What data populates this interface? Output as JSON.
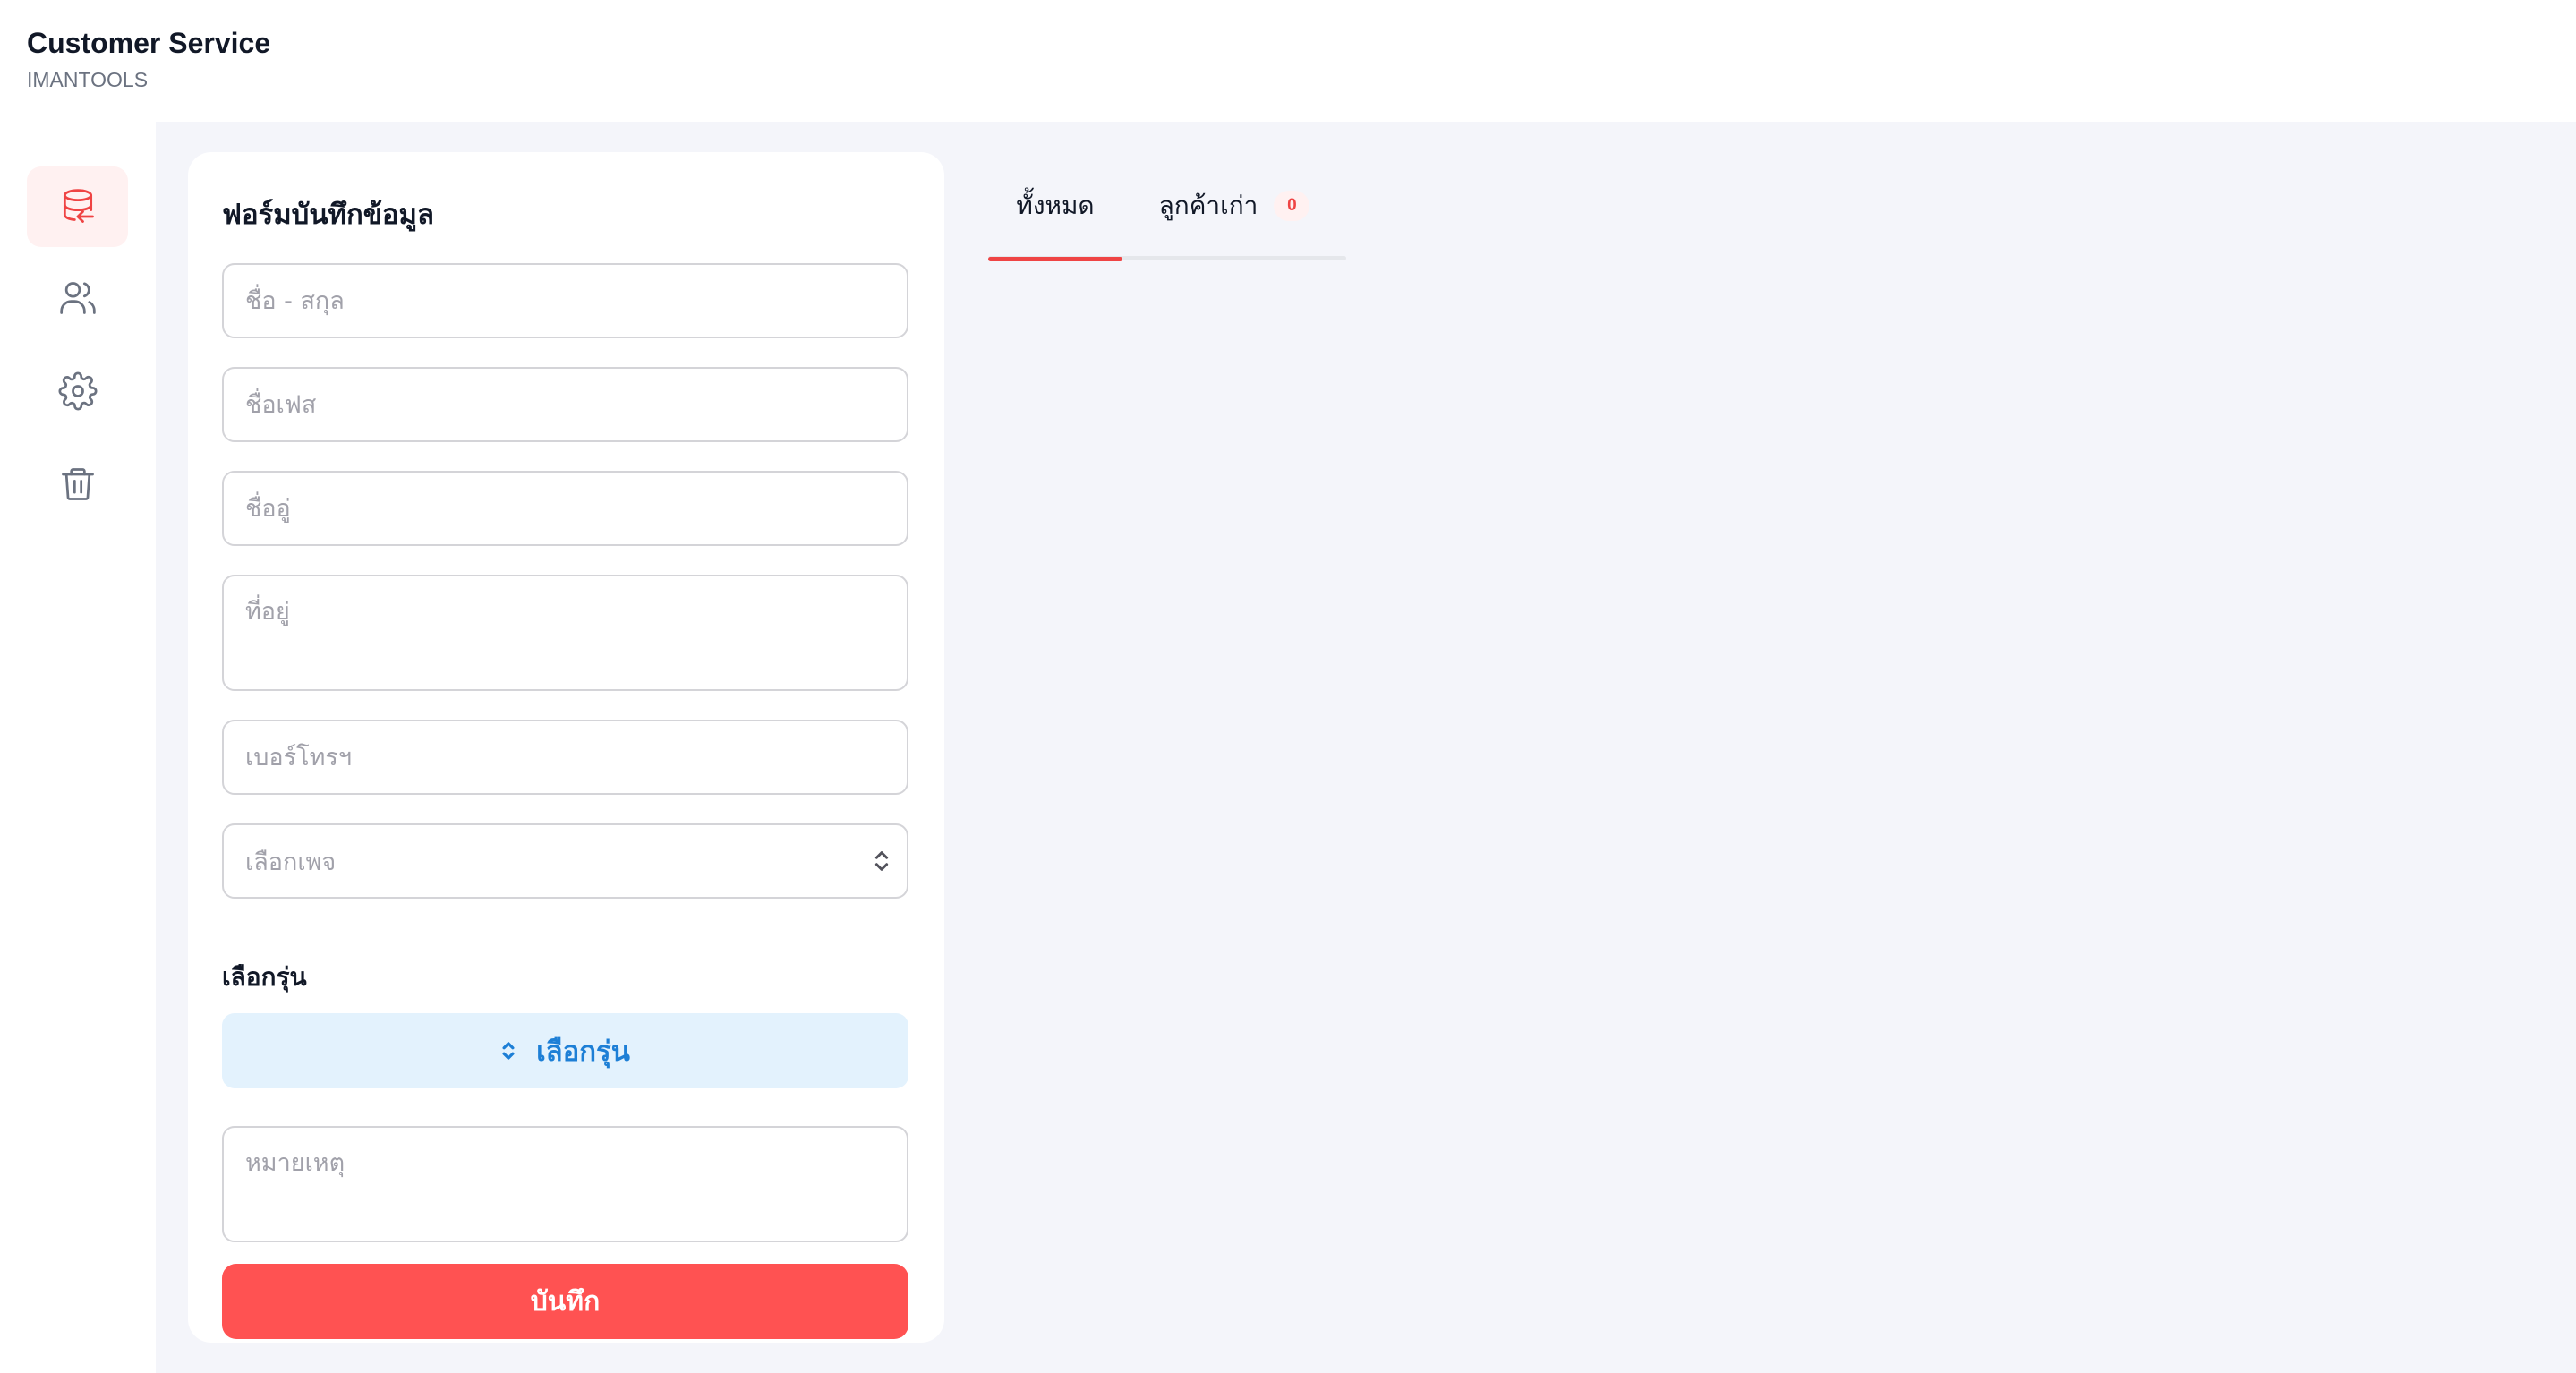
{
  "app": {
    "title": "Customer Service",
    "subtitle": "IMANTOOLS"
  },
  "sidebar": {
    "items": [
      {
        "name": "database-import",
        "icon": "database-import-icon",
        "active": true
      },
      {
        "name": "users",
        "icon": "users-icon",
        "active": false
      },
      {
        "name": "settings",
        "icon": "gear-icon",
        "active": false
      },
      {
        "name": "trash",
        "icon": "trash-icon",
        "active": false
      }
    ]
  },
  "form": {
    "title": "ฟอร์มบันทึกข้อมูล",
    "fullname_placeholder": "ชื่อ - สกุล",
    "facebook_name_placeholder": "ชื่อเฟส",
    "partner_name_placeholder": "ชื่ออู่",
    "address_placeholder": "ที่อยู่",
    "phone_placeholder": "เบอร์โทรฯ",
    "page_select_placeholder": "เลือกเพจ",
    "model_section_label": "เลือกรุ่น",
    "model_button_label": "เลือกรุ่น",
    "note_placeholder": "หมายเหตุ",
    "save_label": "บันทึก"
  },
  "tabs": [
    {
      "label": "ทั้งหมด",
      "active": true
    },
    {
      "label": "ลูกค้าเก่า",
      "badge": "0",
      "active": false
    }
  ],
  "colors": {
    "accent": "#ef4444",
    "save_button": "#ff5252",
    "model_button_bg": "#e3f2fd",
    "model_button_text": "#1d7fd6",
    "main_bg": "#f4f5fa"
  }
}
